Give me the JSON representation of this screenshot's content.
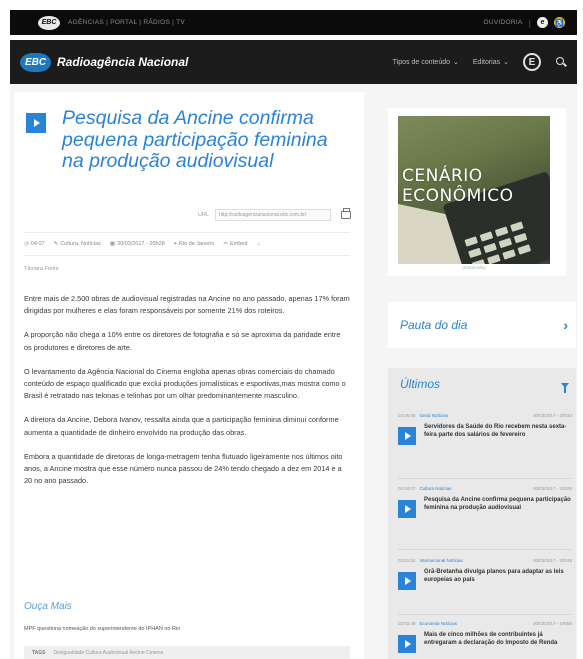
{
  "topbar": {
    "logo": "EBC",
    "links": "AGÊNCIAS | PORTAL | RÁDIOS | TV",
    "ouvidoria": "OUVIDORIA",
    "icons": [
      "ebc-icon",
      "accessibility-icon"
    ]
  },
  "nav": {
    "logo": "EBC",
    "brand": "Radioagência Nacional",
    "menu": [
      {
        "label": "Tipos de conteúdo"
      },
      {
        "label": "Editorias"
      }
    ],
    "e_button": "E"
  },
  "article": {
    "headline": "Pesquisa da Ancine confirma pequena participação feminina na produção audiovisual",
    "url_label": "URL",
    "url_value": "http://radioagencianacional.ebc.com.br/",
    "meta": {
      "duration": "04:07",
      "category": "Cultura, Notícias",
      "date": "30/03/2017 - 20h28",
      "location": "Rio de Janeiro",
      "download": "Embed"
    },
    "author": "Tâmara Freire",
    "paragraphs": [
      "Entre mais de 2.500 obras de audiovisual registradas na Ancine no ano passado, apenas 17% foram dirigidas por mulheres e elas foram responsáveis por somente 21% dos roteiros.",
      "A proporção não chega a 10% entre os diretores de fotografia e só se aproxima da paridade entre os produtores e diretores de arte.",
      "O levantamento da Agência Nacional do Cinema engloba apenas obras comerciais do chamado conteúdo de espaço qualificado que exclui produções jornalísticas e esportivas,mas mostra como o Brasil é retratado nas telonas e telinhas por um olhar predominantemente masculino.",
      "A diretora da Ancine, Debora Ivanov, ressalta ainda que a participação feminina diminui conforme aumenta a quantidade de dinheiro envolvido na produção das obras.",
      "Embora a quantidade de diretoras de longa-metragem tenha flutuado ligeiramente nos últimos oito anos, a  Ancine mostra que esse número nunca passou de 24%  tendo chegado a dez em 2014 e a 20 no ano passado."
    ],
    "ouca_mais": "Ouça Mais",
    "related": "MPF questiona nomeação do superintendente do IPHAN no Rio",
    "tags_label": "TAGS",
    "tags": "Desigualdade  Cultura  Audiovisual  Ancine  Cinema"
  },
  "sidebar": {
    "promo_title": "CENÁRIO ECONÔMICO",
    "promo_caption": "(Foto/Leão)",
    "pauta": "Pauta do dia",
    "ultimas": "Últimos",
    "news": [
      {
        "time": "03:06:58",
        "cats": "Geral  Notícias",
        "date": "30/03/2017 - 20h33",
        "title": "Servidores da Saúde do Rio recebem nesta sexta-feira parte dos salários de fevereiro"
      },
      {
        "time": "03:04:07",
        "cats": "Cultura  Notícias",
        "date": "30/03/2017 - 20h28",
        "title": "Pesquisa da Ancine confirma pequena participação feminina na produção audiovisual"
      },
      {
        "time": "03:01:04",
        "cats": "Internacional  Notícias",
        "date": "30/03/2017 - 20h19",
        "title": "Grã-Bretanha divulga planos para adaptar as leis europeias ao país"
      },
      {
        "time": "03:02:48",
        "cats": "Economia  Notícias",
        "date": "30/03/2017 - 19h56",
        "title": "Mais de cinco milhões de contribuintes já entregaram a declaração do Imposto de Renda"
      }
    ]
  },
  "colors": {
    "accent": "#2a84d6",
    "topbar": "#0b0b0b",
    "navbar": "#1c1c1c",
    "ouvidoria_icon": "#f3c300"
  }
}
